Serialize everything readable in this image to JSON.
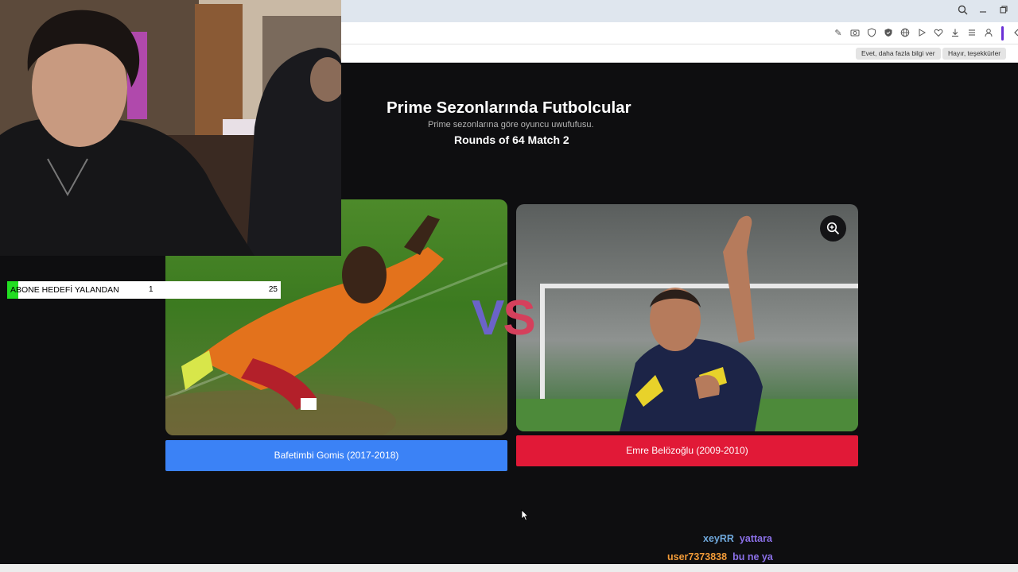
{
  "browser": {
    "icons": [
      "search-icon",
      "minimize-icon",
      "restore-icon"
    ],
    "toolbar_icons": [
      "edit-icon",
      "camera-icon",
      "shield-icon",
      "shield-check-icon",
      "globe-icon",
      "play-icon",
      "heart-icon",
      "download-icon",
      "menu-icon",
      "profile-icon",
      "extension-icon",
      "chevron-left-icon"
    ],
    "notification": {
      "yes_label": "Evet, daha fazla bilgi ver",
      "no_label": "Hayır, teşekkürler"
    }
  },
  "page": {
    "title": "Prime Sezonlarında Futbolcular",
    "subtitle": "Prime sezonlarına göre oyuncu uwufufusu.",
    "round": "Rounds of 64 Match 2",
    "vs_v": "V",
    "vs_s": "S",
    "zoom_icon": "zoom-in-icon",
    "left_player": "Bafetimbi Gomis (2017-2018)",
    "right_player": "Emre Belözoğlu (2009-2010)",
    "colors": {
      "left_accent": "#3b82f6",
      "right_accent": "#e11937",
      "vs_v": "#6b63c8",
      "vs_s": "#d5405c"
    }
  },
  "overlay": {
    "goal": {
      "label": "ABONE HEDEFİ YALANDAN",
      "current": "1",
      "target": "25",
      "progress": 0.04
    }
  },
  "chat": [
    {
      "user": "xeyRR",
      "message": "yattara",
      "color": "#6fa8dc"
    },
    {
      "user": "user7373838",
      "message": "bu ne ya",
      "color": "#f29b38"
    }
  ]
}
